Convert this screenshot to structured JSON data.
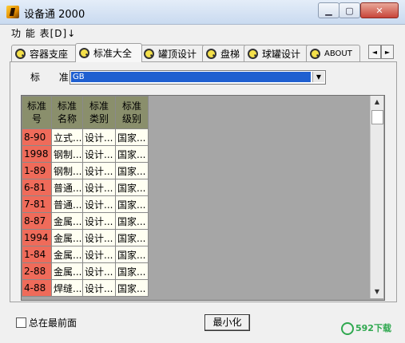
{
  "window": {
    "title": "设备通 2000"
  },
  "menu": {
    "label": "功 能 表[D]↓"
  },
  "tabs": [
    {
      "label": "容器支座",
      "active": false
    },
    {
      "label": "标准大全",
      "active": true
    },
    {
      "label": "罐顶设计",
      "active": false
    },
    {
      "label": "盘梯",
      "active": false
    },
    {
      "label": "球罐设计",
      "active": false
    },
    {
      "label": "ABOUT",
      "active": false
    }
  ],
  "tab_scroll": {
    "left": "◄",
    "right": "►"
  },
  "standard": {
    "label": "标  准:",
    "value": "GB"
  },
  "grid": {
    "headers": [
      {
        "line1": "标准",
        "line2": "号"
      },
      {
        "line1": "标准",
        "line2": "名称"
      },
      {
        "line1": "标准",
        "line2": "类别"
      },
      {
        "line1": "标准",
        "line2": "级别"
      }
    ],
    "rows": [
      [
        "8-90",
        "立式...",
        "设计...",
        "国家..."
      ],
      [
        "1998",
        "钢制...",
        "设计...",
        "国家..."
      ],
      [
        "1-89",
        "钢制...",
        "设计...",
        "国家..."
      ],
      [
        "6-81",
        "普通...",
        "设计...",
        "国家..."
      ],
      [
        "7-81",
        "普通...",
        "设计...",
        "国家..."
      ],
      [
        "8-87",
        "金属...",
        "设计...",
        "国家..."
      ],
      [
        "1994",
        "金属...",
        "设计...",
        "国家..."
      ],
      [
        "1-84",
        "金属...",
        "设计...",
        "国家..."
      ],
      [
        "2-88",
        "金属...",
        "设计...",
        "国家..."
      ],
      [
        "4-88",
        "焊缝...",
        "设计...",
        "国家..."
      ]
    ]
  },
  "bottom": {
    "always_on_top_label": "总在最前面",
    "always_on_top_checked": false,
    "minimize_label": "最小化"
  },
  "watermark": "592下载",
  "colors": {
    "key_cell": "#ef6b5a",
    "header_cell": "#8a8f6c",
    "selection": "#1f5fd0"
  }
}
